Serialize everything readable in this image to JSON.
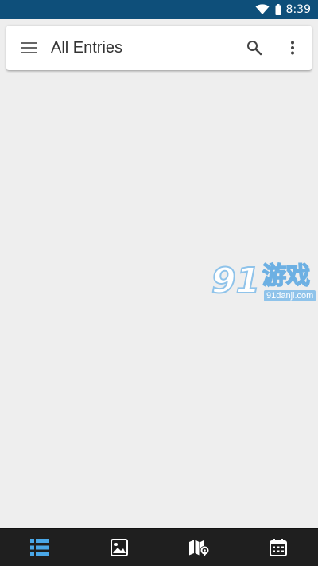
{
  "status_bar": {
    "time": "8:39",
    "icons": [
      "wifi-icon",
      "battery-icon"
    ]
  },
  "toolbar": {
    "title": "All Entries",
    "menu_icon": "hamburger-menu-icon",
    "search_icon": "search-icon",
    "overflow_icon": "more-vertical-icon"
  },
  "watermark": {
    "digits": "91",
    "chinese": "游戏",
    "site": "91danji.com"
  },
  "bottom_nav": {
    "items": [
      {
        "icon": "list-icon",
        "active": true
      },
      {
        "icon": "image-icon",
        "active": false
      },
      {
        "icon": "map-icon",
        "active": false
      },
      {
        "icon": "calendar-icon",
        "active": false
      }
    ],
    "active_color": "#4aa8e8",
    "inactive_color": "#ffffff"
  },
  "colors": {
    "status_bar": "#0e4f7a",
    "background": "#eeeeee",
    "toolbar": "#ffffff",
    "bottom_nav": "#1f1f1f"
  }
}
